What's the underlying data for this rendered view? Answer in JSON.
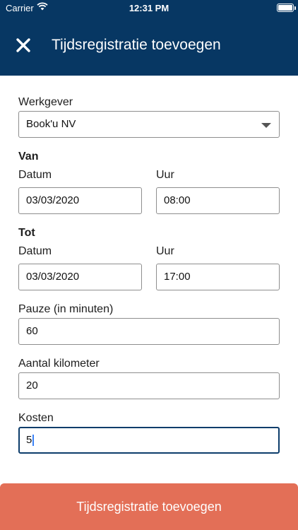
{
  "status_bar": {
    "carrier": "Carrier",
    "time": "12:31 PM"
  },
  "nav": {
    "title": "Tijdsregistratie toevoegen",
    "close_icon": "close-icon"
  },
  "form": {
    "employer": {
      "label": "Werkgever",
      "value": "Book'u NV"
    },
    "from": {
      "heading": "Van",
      "date_label": "Datum",
      "date_value": "03/03/2020",
      "time_label": "Uur",
      "time_value": "08:00"
    },
    "to": {
      "heading": "Tot",
      "date_label": "Datum",
      "date_value": "03/03/2020",
      "time_label": "Uur",
      "time_value": "17:00"
    },
    "pause": {
      "label": "Pauze (in minuten)",
      "value": "60"
    },
    "km": {
      "label": "Aantal kilometer",
      "value": "20"
    },
    "costs": {
      "label": "Kosten",
      "value": "5"
    }
  },
  "submit_label": "Tijdsregistratie toevoegen",
  "colors": {
    "header": "#073763",
    "submit": "#e36f57",
    "active_border": "#0d3d6b"
  }
}
